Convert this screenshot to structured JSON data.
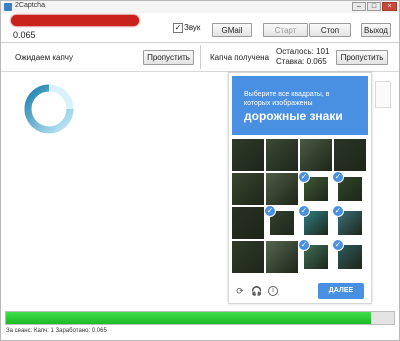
{
  "window": {
    "title": "2Captcha"
  },
  "header": {
    "balance": "0.065",
    "sound_label": "Звук",
    "sound_checked": "✓",
    "buttons": {
      "gmail": "GMail",
      "start": "Старт",
      "stop": "Стоп",
      "exit": "Выход"
    }
  },
  "left_panel": {
    "status": "Ожидаем капчу",
    "skip": "Пропустить"
  },
  "right_panel": {
    "status": "Капча получена",
    "remaining": "Осталось: 101",
    "bet": "Ставка: 0.065",
    "skip": "Пропустить"
  },
  "recaptcha": {
    "line1": "Выберите все квадраты, в",
    "line2": "которых изображены",
    "target": "дорожные знаки",
    "verify": "ДАЛЕЕ",
    "icons": [
      "reload-icon",
      "audio-icon",
      "info-icon"
    ],
    "tiles": [
      {
        "color": "#2e3a2a",
        "selected": false
      },
      {
        "color": "#3c4a36",
        "selected": false
      },
      {
        "color": "#4a5a44",
        "selected": false
      },
      {
        "color": "#2a3528",
        "selected": false
      },
      {
        "color": "#39462f",
        "selected": false
      },
      {
        "color": "#4e5c45",
        "selected": false
      },
      {
        "color": "#3f5836",
        "selected": true
      },
      {
        "color": "#2f4629",
        "selected": true
      },
      {
        "color": "#263022",
        "selected": false
      },
      {
        "color": "#34422d",
        "selected": true
      },
      {
        "color": "#2f7f86",
        "selected": true
      },
      {
        "color": "#3b6f7c",
        "selected": true
      },
      {
        "color": "#303b2a",
        "selected": false
      },
      {
        "color": "#556650",
        "selected": false
      },
      {
        "color": "#3f6f58",
        "selected": true
      },
      {
        "color": "#2e5a5a",
        "selected": true
      }
    ]
  },
  "progress": {
    "fraction": 0.94
  },
  "status_bar": "За сеанс: Капч: 1 Заработано: 0.065",
  "colors": {
    "accent": "#4a90e2",
    "progress": "#22c02c",
    "redaction": "#c9211c"
  }
}
